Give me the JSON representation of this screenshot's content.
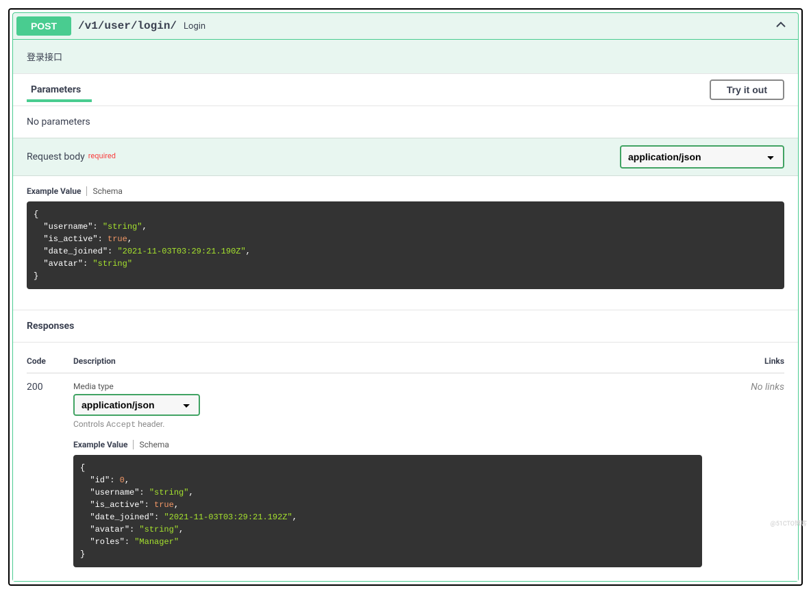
{
  "operation": {
    "method": "POST",
    "path": "/v1/user/login/",
    "summary": "Login",
    "description": "登录接口"
  },
  "parameters": {
    "tab_label": "Parameters",
    "try_it_out": "Try it out",
    "no_params": "No parameters"
  },
  "request_body": {
    "title": "Request body",
    "required_label": "required",
    "content_type": "application/json",
    "tabs": {
      "example": "Example Value",
      "schema": "Schema"
    },
    "example": {
      "username": "string",
      "is_active": true,
      "date_joined": "2021-11-03T03:29:21.190Z",
      "avatar": "string"
    }
  },
  "responses": {
    "title": "Responses",
    "columns": {
      "code": "Code",
      "description": "Description",
      "links": "Links"
    },
    "rows": [
      {
        "code": "200",
        "media_type_label": "Media type",
        "media_type": "application/json",
        "controls_accept_prefix": "Controls ",
        "controls_accept_kw": "Accept",
        "controls_accept_suffix": " header.",
        "tabs": {
          "example": "Example Value",
          "schema": "Schema"
        },
        "links": "No links",
        "example": {
          "id": 0,
          "username": "string",
          "is_active": true,
          "date_joined": "2021-11-03T03:29:21.192Z",
          "avatar": "string",
          "roles": "Manager"
        }
      }
    ]
  },
  "watermark": "@51CTO博客"
}
